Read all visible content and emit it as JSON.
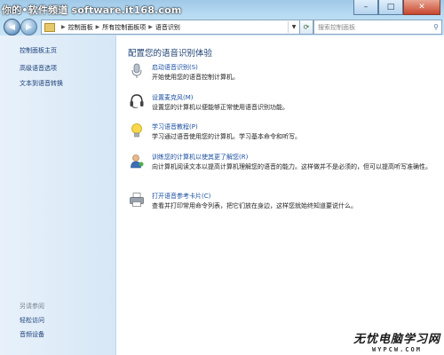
{
  "watermark_top": "你的•软件频道 software.it168.com",
  "address": {
    "crumbs": [
      "控制面板",
      "所有控制面板项",
      "语音识别"
    ],
    "search_placeholder": "搜索控制面板"
  },
  "window_buttons": {
    "minimize": "–",
    "maximize": "□",
    "close": "✕"
  },
  "sidebar": {
    "links": [
      "控制面板主页",
      "高级语音选项",
      "文本到语音转换"
    ],
    "see_also_heading": "另请参阅",
    "see_also_links": [
      "轻松访问",
      "音频设备"
    ]
  },
  "main": {
    "title": "配置您的语音识别体验",
    "tasks": [
      {
        "icon": "microphone-icon",
        "link": "启动语音识别(S)",
        "desc": "开始使用您的语音控制计算机。"
      },
      {
        "icon": "headset-icon",
        "link": "设置麦克风(M)",
        "desc": "设置您的计算机以便能够正常使用语音识别功能。"
      },
      {
        "icon": "lightbulb-icon",
        "link": "学习语音教程(P)",
        "desc": "学习通过语音使用您的计算机。学习基本命令和听写。"
      },
      {
        "icon": "user-train-icon",
        "link": "训练您的计算机以使其更了解您(R)",
        "desc": "向计算机阅读文本以提高计算机理解您的语音的能力。这样做并不是必须的，但可以提高听写准确性。"
      },
      {
        "icon": "printer-icon",
        "link": "打开语音参考卡片(C)",
        "desc": "查看并打印常用命令列表，把它们放在身边，这样您就始终知道要说什么。"
      }
    ]
  },
  "watermark_bottom": {
    "cn": "无忧电脑学习网",
    "en": "WYPCW.COM"
  }
}
